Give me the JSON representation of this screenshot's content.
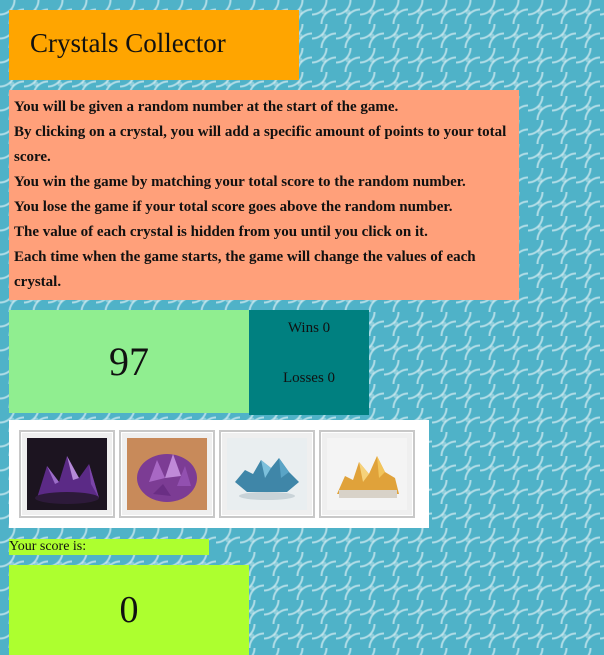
{
  "header": {
    "title": "Crystals Collector"
  },
  "instructions": [
    "You will be given a random number at the start of the game.",
    "By clicking on a crystal, you will add a specific amount of points to your total score.",
    "You win the game by matching your total score to the random number.",
    "You lose the game if your total score goes above the random number.",
    "The value of each crystal is hidden from you until you click on it.",
    "Each time when the game starts, the game will change the values of each crystal."
  ],
  "target_number": "97",
  "stats": {
    "wins": "Wins 0",
    "losses": "Losses 0"
  },
  "crystals": [
    {
      "icon": "amethyst-cluster-icon",
      "color": "#5b2a86"
    },
    {
      "icon": "amethyst-geode-icon",
      "color": "#8e4fa8"
    },
    {
      "icon": "blue-crystal-icon",
      "color": "#3f86a8"
    },
    {
      "icon": "citrine-crystal-icon",
      "color": "#e0a23a"
    }
  ],
  "score": {
    "label": "Your score is:",
    "value": "0"
  },
  "colors": {
    "background": "#4fb2c8",
    "title_box": "#ffa500",
    "instructions_box": "#ffa07a",
    "target_box": "#90ee90",
    "stats_box": "#008080",
    "score_box": "#adff2f"
  }
}
